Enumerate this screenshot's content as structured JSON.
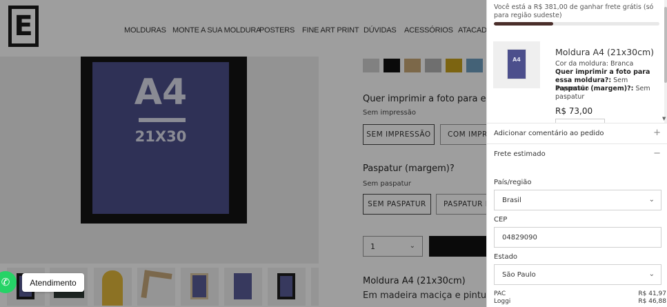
{
  "store": {
    "logo_letter": "E",
    "nav": [
      "MOLDURAS",
      "MONTE A SUA MOLDURA",
      "POSTERS",
      "FINE ART PRINT",
      "DÚVIDAS",
      "ACESSÓRIOS",
      "ATACADO"
    ]
  },
  "product": {
    "preview": {
      "format": "A4",
      "size": "21X30"
    },
    "swatch_colors": [
      "#d0d0d0",
      "#111111",
      "#c9a877",
      "#b4b4b4",
      "#c8a21c",
      "#6f9ec0"
    ],
    "print_option": {
      "title": "Quer imprimir a foto para essa",
      "selected": "Sem impressão",
      "buttons": [
        "SEM IMPRESSÃO",
        "COM IMPRESSÃO"
      ]
    },
    "mat_option": {
      "title": "Paspatur (margem)?",
      "selected": "Sem paspatur",
      "buttons": [
        "SEM PASPATUR",
        "PASPATUR DE"
      ]
    },
    "quantity": "1",
    "description_title": "Moldura A4 (21x30cm)",
    "description_text": "Em madeira maciça e pintura la"
  },
  "whatsapp": {
    "label": "Atendimento"
  },
  "cart": {
    "shipping_message": "Você está a R$ 381,00 de ganhar frete grátis (só para região sudeste)",
    "shipping_progress": 0.36,
    "item": {
      "thumb_text": "A4",
      "name": "Moldura A4 (21x30cm)",
      "frame_color_label": "Cor da moldura:",
      "frame_color_value": "Branca",
      "print_label": "Quer imprimir a foto para essa moldura?:",
      "print_value": "Sem impressão",
      "mat_label": "Paspatur (margem)?:",
      "mat_value": "Sem paspatur",
      "price": "R$ 73,00"
    },
    "comment_label": "Adicionar comentário ao pedido",
    "comment_sign": "+",
    "shipping_estimate_label": "Frete estimado",
    "shipping_estimate_sign": "−",
    "country_label": "País/região",
    "country_value": "Brasil",
    "zip_label": "CEP",
    "zip_value": "04829090",
    "state_label": "Estado",
    "state_value": "São Paulo",
    "rates": [
      {
        "name": "PAC",
        "price": "R$ 41,97"
      },
      {
        "name": "Loggi",
        "price": "R$ 46,88"
      }
    ]
  }
}
